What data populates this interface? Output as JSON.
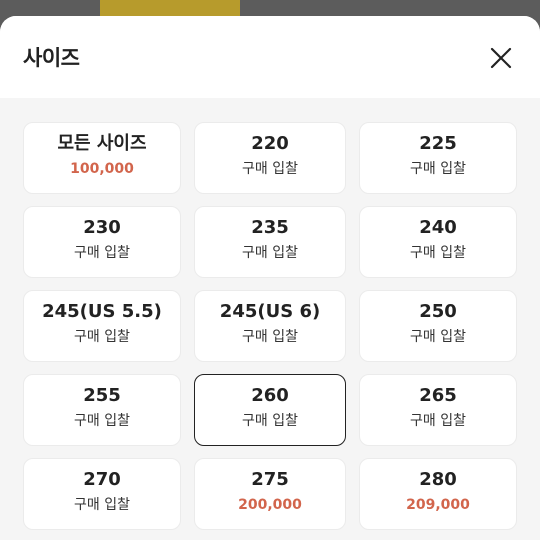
{
  "sheet": {
    "title": "사이즈",
    "close_icon": "close-x-icon"
  },
  "options": [
    {
      "size": "모든 사이즈",
      "price": "100,000",
      "has_price": true,
      "selected": false
    },
    {
      "size": "220",
      "price": "구매 입찰",
      "has_price": false,
      "selected": false
    },
    {
      "size": "225",
      "price": "구매 입찰",
      "has_price": false,
      "selected": false
    },
    {
      "size": "230",
      "price": "구매 입찰",
      "has_price": false,
      "selected": false
    },
    {
      "size": "235",
      "price": "구매 입찰",
      "has_price": false,
      "selected": false
    },
    {
      "size": "240",
      "price": "구매 입찰",
      "has_price": false,
      "selected": false
    },
    {
      "size": "245(US 5.5)",
      "price": "구매 입찰",
      "has_price": false,
      "selected": false
    },
    {
      "size": "245(US 6)",
      "price": "구매 입찰",
      "has_price": false,
      "selected": false
    },
    {
      "size": "250",
      "price": "구매 입찰",
      "has_price": false,
      "selected": false
    },
    {
      "size": "255",
      "price": "구매 입찰",
      "has_price": false,
      "selected": false
    },
    {
      "size": "260",
      "price": "구매 입찰",
      "has_price": false,
      "selected": true
    },
    {
      "size": "265",
      "price": "구매 입찰",
      "has_price": false,
      "selected": false
    },
    {
      "size": "270",
      "price": "구매 입찰",
      "has_price": false,
      "selected": false
    },
    {
      "size": "275",
      "price": "200,000",
      "has_price": true,
      "selected": false
    },
    {
      "size": "280",
      "price": "209,000",
      "has_price": true,
      "selected": false
    }
  ],
  "colors": {
    "price_accent": "#d2654c",
    "selected_border": "#222222",
    "grid_background": "#f5f5f5"
  }
}
